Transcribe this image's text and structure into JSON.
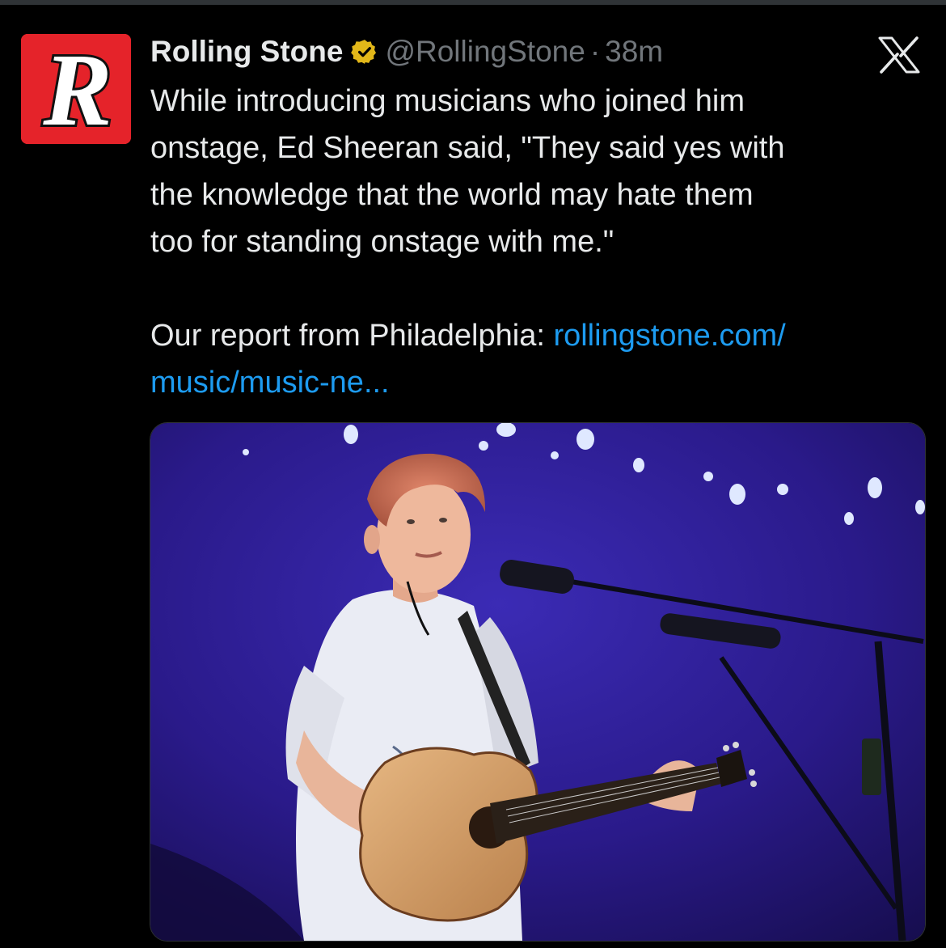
{
  "tweet": {
    "display_name": "Rolling Stone",
    "handle": "@RollingStone",
    "separator": "·",
    "time": "38m",
    "verified": true,
    "avatar_letter": "R",
    "avatar_icon": "rolling-stone-logo",
    "platform_icon": "x-logo-icon",
    "text_lines": [
      "While introducing musicians who joined him",
      "onstage, Ed Sheeran said, \"They said yes with",
      "the knowledge that the world may hate them",
      "too for standing onstage with me.\""
    ],
    "report_prefix": "Our report from Philadelphia: ",
    "link_line1": "rollingstone.com/",
    "link_line2": "music/music-ne..."
  },
  "colors": {
    "background": "#000000",
    "text": "#e7e9ea",
    "secondary_text": "#71767b",
    "link": "#1d9bf0",
    "verified_badge": "#e2b719",
    "avatar_bg": "#e5232a"
  },
  "media": {
    "kind": "concert-photo",
    "subject": "musician-with-acoustic-guitar-on-stage"
  }
}
